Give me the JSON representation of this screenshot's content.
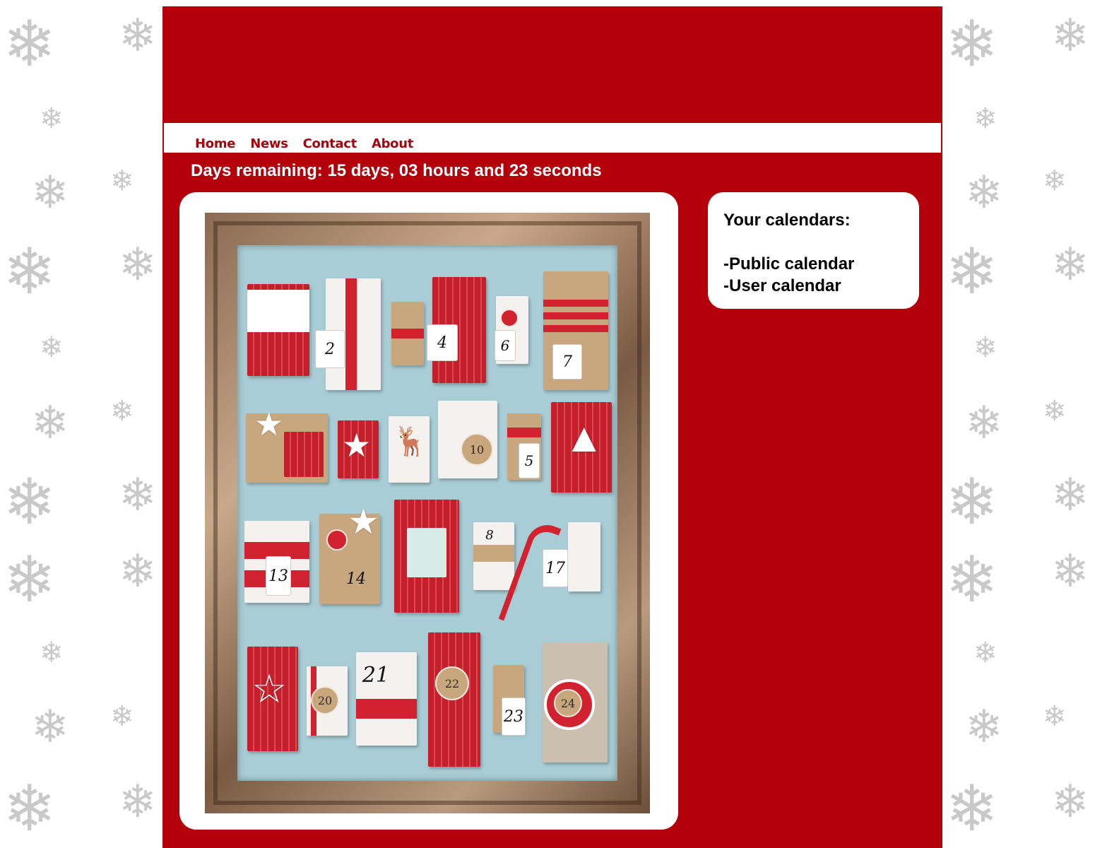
{
  "nav": {
    "home": "Home",
    "news": "News",
    "contact": "Contact",
    "about": "About"
  },
  "countdown": {
    "text": "Days remaining: 15 days, 03 hours and 23 seconds"
  },
  "sidebar": {
    "heading": "Your calendars:",
    "items": [
      "-Public calendar",
      "-User calendar"
    ]
  },
  "calendar_image": {
    "tags": [
      "2",
      "4",
      "6",
      "7",
      "10",
      "5",
      "13",
      "14",
      "8",
      "17",
      "21",
      "20",
      "22",
      "23",
      "24"
    ]
  },
  "colors": {
    "page_red": "#b3000b",
    "nav_text": "#a3060f",
    "board_blue": "#a9cdd6"
  }
}
